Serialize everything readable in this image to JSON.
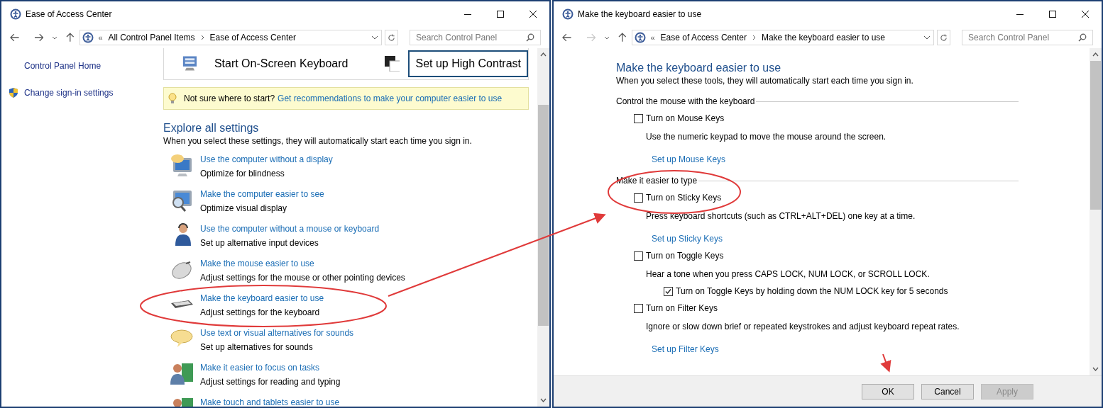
{
  "left_window": {
    "title": "Ease of Access Center",
    "forward_enabled": true,
    "address_overflow": "«",
    "address": [
      "All Control Panel Items",
      "Ease of Access Center"
    ],
    "search": {
      "placeholder": "Search Control Panel"
    },
    "sidebar": [
      {
        "label": "Control Panel Home",
        "kind": "plain"
      },
      {
        "label": "Change sign-in settings",
        "kind": "shield"
      }
    ],
    "quick_tools": [
      {
        "label": "Start On-Screen Keyboard",
        "focused": false
      },
      {
        "label": "Set up High Contrast",
        "focused": true
      }
    ],
    "tip": {
      "text": "Not sure where to start?",
      "link": "Get recommendations to make your computer easier to use"
    },
    "heading": "Explore all settings",
    "description": "When you select these settings, they will automatically start each time you sign in.",
    "settings": [
      {
        "link": "Use the computer without a display",
        "description": "Optimize for blindness"
      },
      {
        "link": "Make the computer easier to see",
        "description": "Optimize visual display"
      },
      {
        "link": "Use the computer without a mouse or keyboard",
        "description": "Set up alternative input devices"
      },
      {
        "link": "Make the mouse easier to use",
        "description": "Adjust settings for the mouse or other pointing devices"
      },
      {
        "link": "Make the keyboard easier to use",
        "description": "Adjust settings for the keyboard"
      },
      {
        "link": "Use text or visual alternatives for sounds",
        "description": "Set up alternatives for sounds"
      },
      {
        "link": "Make it easier to focus on tasks",
        "description": "Adjust settings for reading and typing"
      },
      {
        "link": "Make touch and tablets easier to use"
      }
    ]
  },
  "right_window": {
    "title": "Make the keyboard easier to use",
    "forward_enabled": false,
    "address_overflow": "«",
    "address": [
      "Ease of Access Center",
      "Make the keyboard easier to use"
    ],
    "search": {
      "placeholder": "Search Control Panel"
    },
    "heading": "Make the keyboard easier to use",
    "description": "When you select these tools, they will automatically start each time you sign in.",
    "groups": [
      {
        "heading": "Control the mouse with the keyboard",
        "options": [
          {
            "label": "Turn on Mouse Keys",
            "checked": false,
            "description": "Use the numeric keypad to move the mouse around the screen.",
            "link": "Set up Mouse Keys"
          }
        ]
      },
      {
        "heading": "Make it easier to type",
        "options": [
          {
            "label": "Turn on Sticky Keys",
            "checked": false,
            "description": "Press keyboard shortcuts (such as CTRL+ALT+DEL) one key at a time.",
            "link": "Set up Sticky Keys"
          },
          {
            "label": "Turn on Toggle Keys",
            "checked": false,
            "description": "Hear a tone when you press CAPS LOCK, NUM LOCK, or SCROLL LOCK.",
            "sub": [
              {
                "label": "Turn on Toggle Keys by holding down the NUM LOCK key for 5 seconds",
                "checked": true
              }
            ]
          },
          {
            "label": "Turn on Filter Keys",
            "checked": false,
            "description": "Ignore or slow down brief or repeated keystrokes and adjust keyboard repeat rates.",
            "link": "Set up Filter Keys"
          }
        ]
      }
    ],
    "buttons": [
      {
        "label": "OK",
        "disabled": false
      },
      {
        "label": "Cancel",
        "disabled": false
      },
      {
        "label": "Apply",
        "disabled": true
      }
    ]
  }
}
